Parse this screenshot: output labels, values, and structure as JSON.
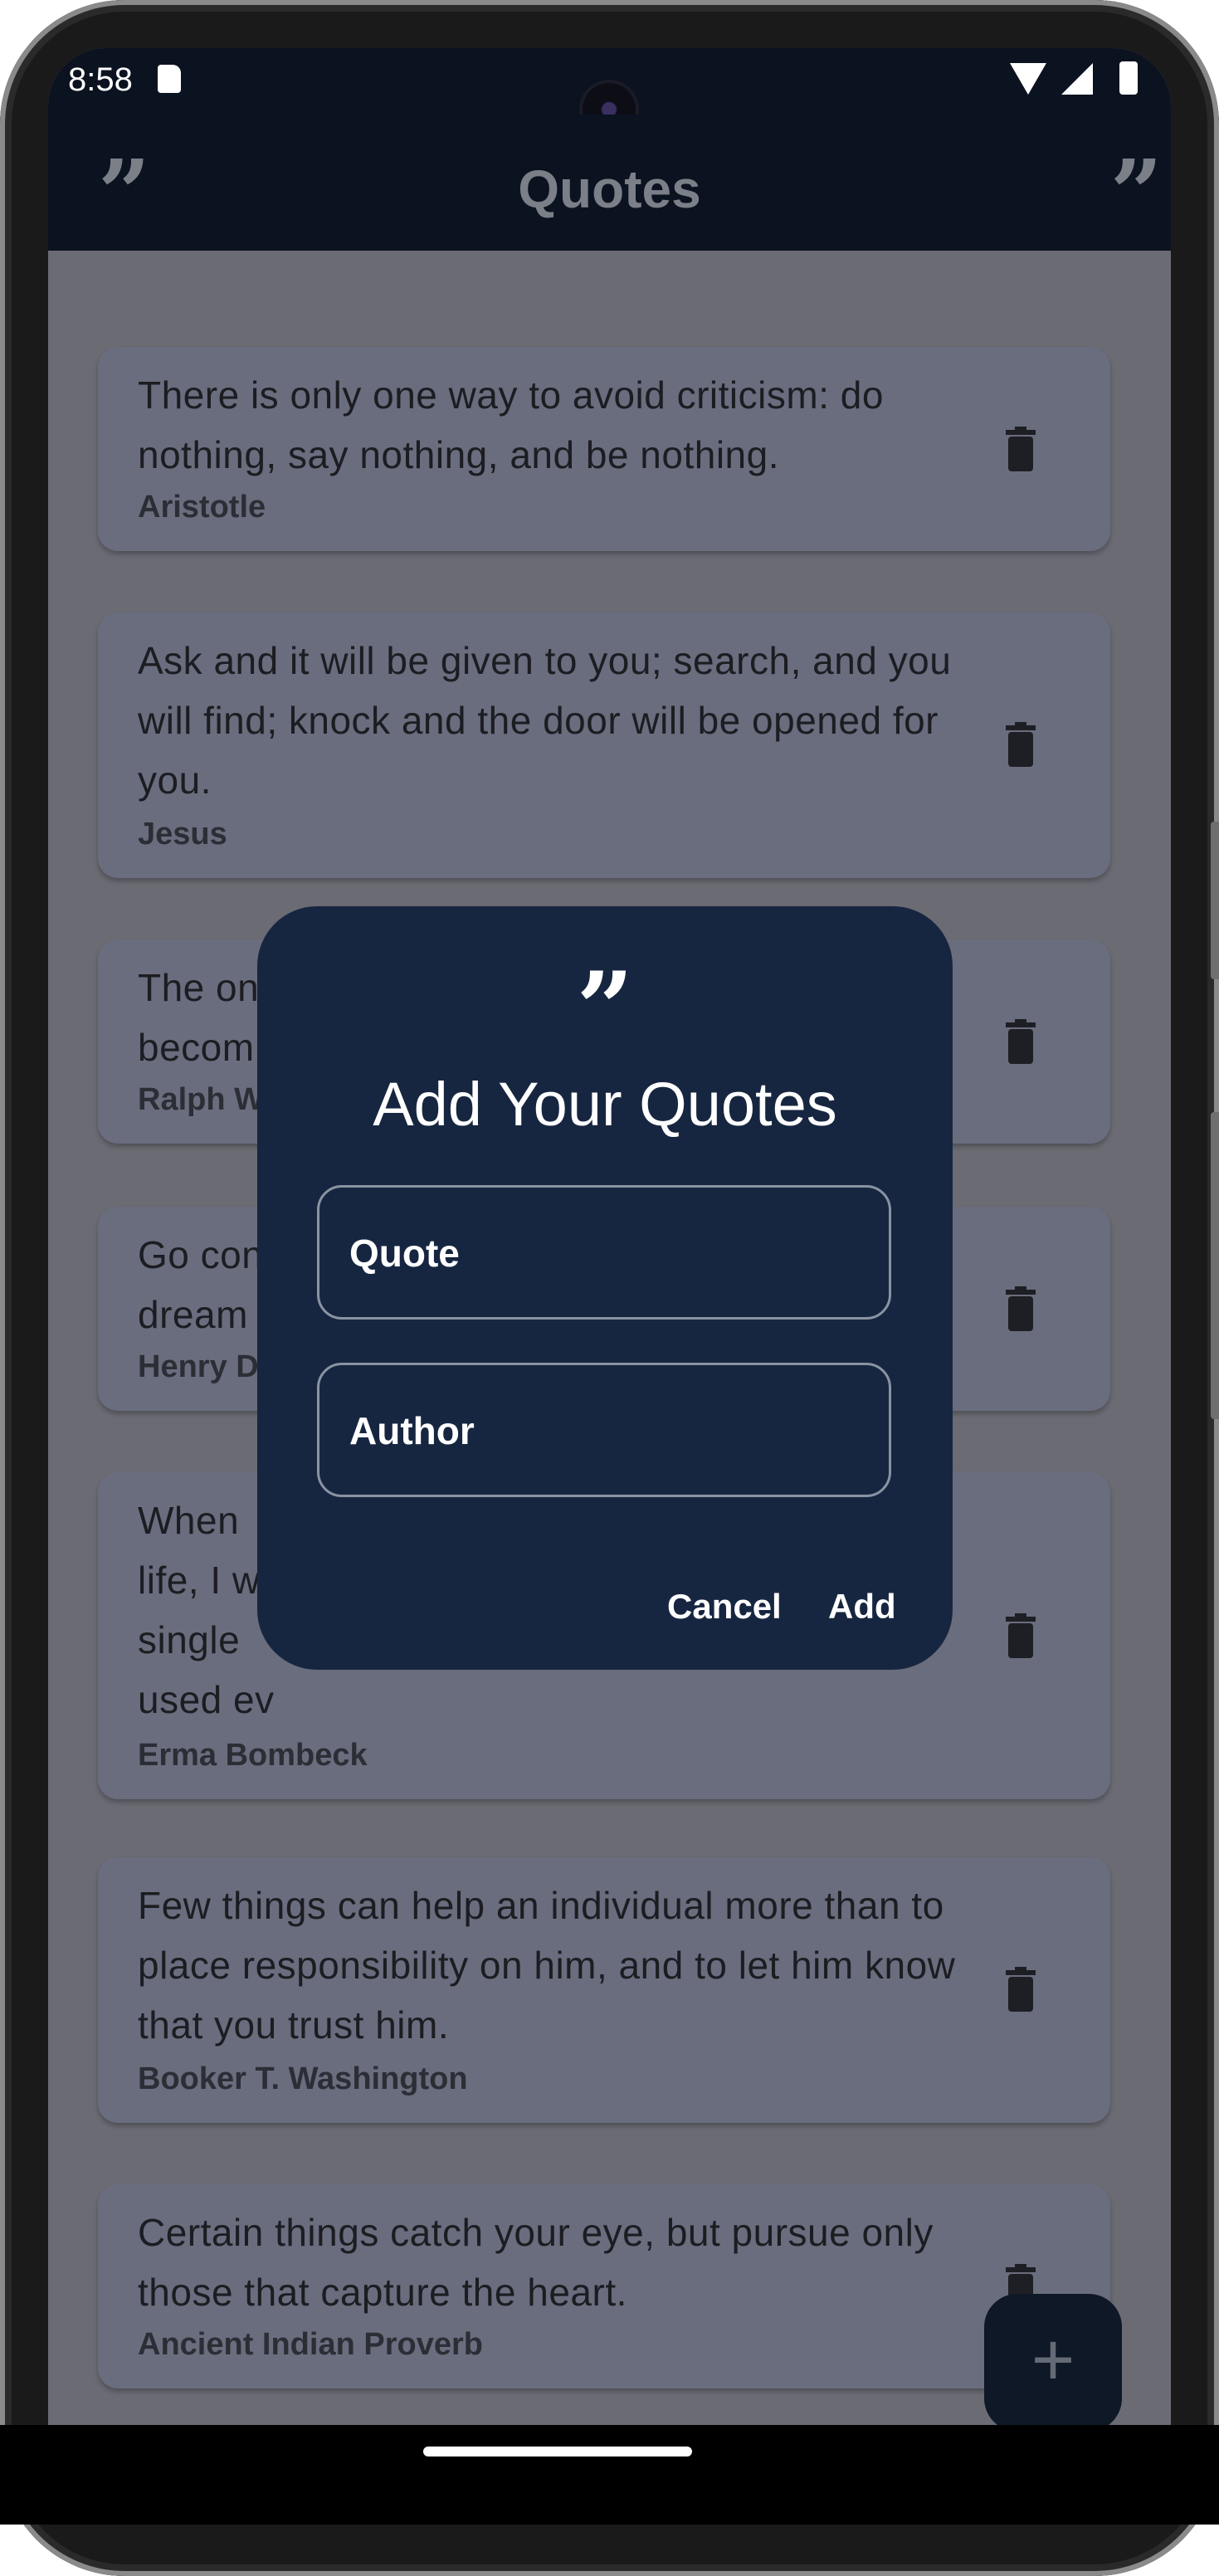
{
  "status_bar": {
    "time": "8:58"
  },
  "app_bar": {
    "title": "Quotes",
    "left_icon": "quote-icon",
    "right_icon": "quote-icon"
  },
  "quotes": [
    {
      "text": "There is only one way to avoid criticism: do nothing, say nothing, and be nothing.",
      "author": "Aristotle"
    },
    {
      "text": "Ask and it will be given to you; search, and you will find; knock and the door will be opened for you.",
      "author": "Jesus"
    },
    {
      "text": "The onl",
      "text2": "becom",
      "author": "Ralph W"
    },
    {
      "text": "Go con",
      "text2": "dream",
      "author": "Henry D"
    },
    {
      "text": "When",
      "text2": "life, I w",
      "text3": "single",
      "text4": "used ev",
      "author": "Erma Bombeck"
    },
    {
      "text": "Few things can help an individual more than to place responsibility on him, and to let him know that you trust him.",
      "author": "Booker T. Washington"
    },
    {
      "text": "Certain things catch your eye, but pursue only those that capture the heart.",
      "author": " Ancient Indian Proverb"
    }
  ],
  "dialog": {
    "icon": "quote-icon",
    "title": "Add Your Quotes",
    "quote_placeholder": "Quote",
    "author_placeholder": "Author",
    "cancel_label": "Cancel",
    "add_label": "Add"
  },
  "fab": {
    "label": "+"
  },
  "colors": {
    "app_bar": "#0b1220",
    "card": "#6a6d7d",
    "dialog": "#172640",
    "fab": "#0f1826"
  }
}
